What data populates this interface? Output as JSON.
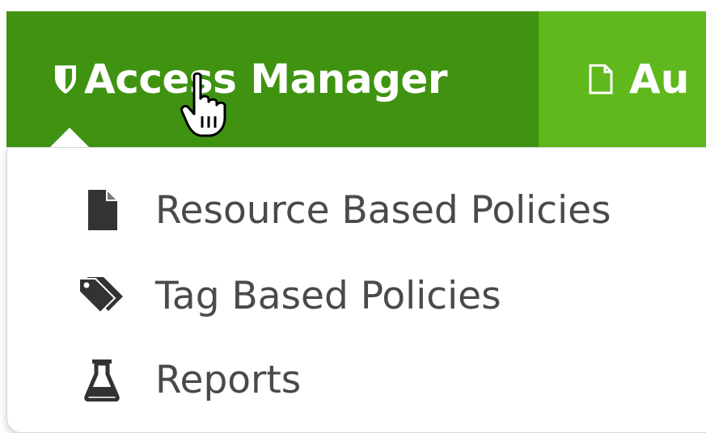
{
  "navbar": {
    "active_item": {
      "label": "Access Manager",
      "icon": "shield-icon"
    },
    "next_item": {
      "label": "Au",
      "icon": "document-outline-icon"
    }
  },
  "dropdown": {
    "items": [
      {
        "label": "Resource Based Policies",
        "icon": "file-icon"
      },
      {
        "label": "Tag Based Policies",
        "icon": "tags-icon"
      },
      {
        "label": "Reports",
        "icon": "flask-icon"
      }
    ]
  },
  "colors": {
    "navbar_active_bg": "#3f9311",
    "navbar_bg": "#5fb81c",
    "menu_text": "#4a4a4a",
    "menu_icon": "#333333"
  }
}
